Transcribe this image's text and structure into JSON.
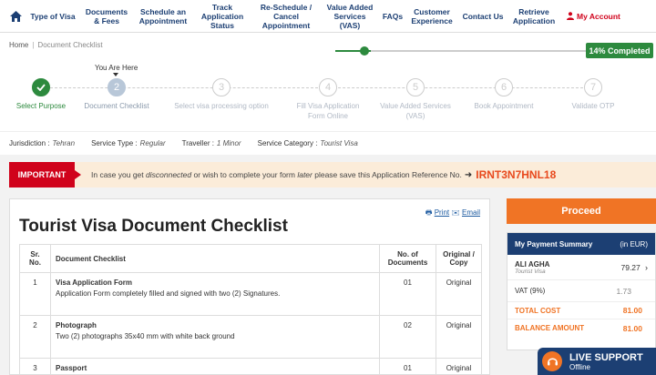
{
  "nav": {
    "items": [
      {
        "label": "Type of Visa"
      },
      {
        "label": "Documents & Fees"
      },
      {
        "label": "Schedule an Appointment"
      },
      {
        "label": "Track Application Status"
      },
      {
        "label": "Re-Schedule / Cancel Appointment"
      },
      {
        "label": "Value Added Services (VAS)"
      },
      {
        "label": "FAQs"
      },
      {
        "label": "Customer Experience"
      },
      {
        "label": "Contact Us"
      },
      {
        "label": "Retrieve Application"
      }
    ],
    "account_label": "My Account",
    "home_icon": "home-icon",
    "account_icon": "user-icon",
    "accent_color": "#d0021b"
  },
  "breadcrumb": {
    "home": "Home",
    "current": "Document Checklist"
  },
  "progress": {
    "percent": 14,
    "label": "14% Completed",
    "color": "#2d8a3e"
  },
  "stepper": {
    "you_are_here": "You Are Here",
    "steps": [
      {
        "number": "1",
        "label": "Select Purpose",
        "state": "done"
      },
      {
        "number": "2",
        "label": "Document Checklist",
        "state": "active"
      },
      {
        "number": "3",
        "label": "Select visa processing option",
        "state": "pending"
      },
      {
        "number": "4",
        "label": "Fill Visa Application Form Online",
        "state": "pending"
      },
      {
        "number": "5",
        "label": "Value Added Services (VAS)",
        "state": "pending"
      },
      {
        "number": "6",
        "label": "Book Appointment",
        "state": "pending"
      },
      {
        "number": "7",
        "label": "Validate OTP",
        "state": "pending"
      }
    ]
  },
  "info": {
    "jurisdiction_label": "Jurisdiction :",
    "jurisdiction_value": "Tehran",
    "service_type_label": "Service Type :",
    "service_type_value": "Regular",
    "traveller_label": "Traveller :",
    "traveller_value": "1 Minor",
    "category_label": "Service Category :",
    "category_value": "Tourist Visa"
  },
  "important": {
    "tag": "IMPORTANT",
    "text_1": "In case you get ",
    "text_2": "disconnected",
    "text_3": " or wish to complete your form ",
    "text_4": "later",
    "text_5": " please save this Application Reference No.",
    "reference": "IRNT3N7HNL18"
  },
  "checklist": {
    "print_label": "Print",
    "email_label": "Email",
    "title": "Tourist Visa Document Checklist",
    "columns": {
      "sr": "Sr. No.",
      "doc": "Document Checklist",
      "count": "No. of Documents",
      "type": "Original / Copy"
    },
    "rows": [
      {
        "sr": "1",
        "name": "Visa Application Form",
        "desc": "Application Form completely filled and signed with two (2) Signatures.",
        "count": "01",
        "type": "Original"
      },
      {
        "sr": "2",
        "name": "Photograph",
        "desc": "Two (2) photographs 35x40 mm with white back ground",
        "count": "02",
        "type": "Original"
      },
      {
        "sr": "3",
        "name": "Passport",
        "desc": "",
        "count": "01",
        "type": "Original"
      }
    ]
  },
  "proceed_label": "Proceed",
  "summary": {
    "title": "My Payment Summary",
    "currency": "(in EUR)",
    "applicant_name": "ALI AGHA",
    "applicant_sub": "Tourist Visa",
    "applicant_amount": "79.27",
    "vat_label": "VAT (9%)",
    "vat_amount": "1.73",
    "total_label": "TOTAL COST",
    "total_amount": "81.00",
    "balance_label": "BALANCE AMOUNT",
    "balance_amount": "81.00",
    "accent": "#f07425"
  },
  "live_support": {
    "title": "LIVE SUPPORT",
    "status": "Offline",
    "icon": "headset-icon"
  }
}
